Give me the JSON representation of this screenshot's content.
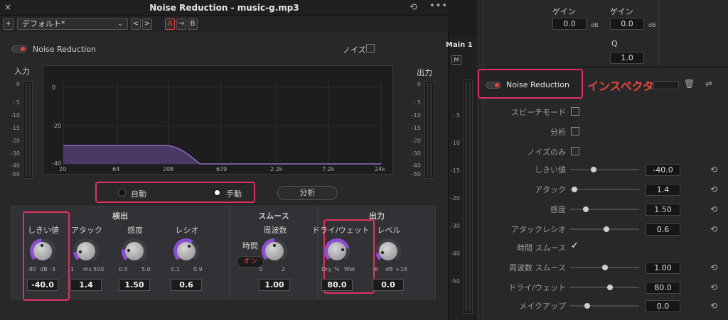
{
  "window": {
    "title": "Noise Reduction - music-g.mp3"
  },
  "toolbar": {
    "add": "+",
    "preset": "デフォルト*",
    "prev": "<",
    "next": ">",
    "ab_a": "A",
    "ab_arrow": "→",
    "ab_b": "B"
  },
  "plugin": {
    "enable_label": "Noise Reduction",
    "noise_label": "ノイズ",
    "input_label": "入力",
    "output_label": "出力",
    "meter_scale": [
      "0",
      "- 5",
      "-10",
      "-15",
      "-20",
      "-30",
      "-40",
      "-50"
    ],
    "graph_y": [
      "0",
      "-20",
      "-40"
    ],
    "graph_x": [
      "20",
      "64",
      "208",
      "679",
      "2.2k",
      "7.2k",
      "24k"
    ],
    "mode_auto": "自動",
    "mode_manual": "手動",
    "analyze": "分析",
    "sections": {
      "detect": "検出",
      "smooth": "スムース",
      "output": "出力"
    },
    "knobs": [
      {
        "label": "しきい値",
        "min": "-80",
        "unit": "dB",
        "max": "-3",
        "value": "-40.0"
      },
      {
        "label": "アタック",
        "min": "1",
        "unit": "ms",
        "max": "500",
        "value": "1.4"
      },
      {
        "label": "感度",
        "min": "0.5",
        "unit": "",
        "max": "5.0",
        "value": "1.50"
      },
      {
        "label": "レシオ",
        "min": "0.1",
        "unit": "",
        "max": "0.9",
        "value": "0.6"
      },
      {
        "label": "周波数",
        "min": "0",
        "unit": "",
        "max": "2",
        "value": "1.00"
      },
      {
        "label": "ドライ/ウェット",
        "min": "Dry",
        "unit": "%",
        "max": "Wet",
        "value": "80.0"
      },
      {
        "label": "レベル",
        "min": "-6",
        "unit": "dB",
        "max": "+18",
        "value": "0.0"
      }
    ],
    "time_label": "時間",
    "time_toggle": "オン",
    "level_zero": "0"
  },
  "mid": {
    "track": "Main 1",
    "m": "M",
    "scale": [
      "- 5",
      "-10",
      "-15",
      "-20",
      "-30",
      "-40",
      "-50"
    ]
  },
  "inspector": {
    "gain1_label": "ゲイン",
    "gain1_value": "0.0",
    "gain1_unit": "dB",
    "gain2_label": "ゲイン",
    "gain2_value": "0.0",
    "gain2_unit": "dB",
    "q_label": "Q",
    "q_value": "1.0",
    "header": "Noise Reduction",
    "annotation": "インスペクタ",
    "checks": [
      {
        "label": "スピーチモード",
        "checked": false
      },
      {
        "label": "分析",
        "checked": false
      },
      {
        "label": "ノイズのみ",
        "checked": false
      }
    ],
    "rows": [
      {
        "label": "しきい値",
        "value": "-40.0",
        "pos": 0.33
      },
      {
        "label": "アタック",
        "value": "1.4",
        "pos": 0.02
      },
      {
        "label": "感度",
        "value": "1.50",
        "pos": 0.2
      },
      {
        "label": "アタックレシオ",
        "value": "0.6",
        "pos": 0.53
      },
      {
        "label": "周波数 スムース",
        "value": "1.00",
        "pos": 0.5
      },
      {
        "label": "ドライ/ウェット",
        "value": "80.0",
        "pos": 0.58
      },
      {
        "label": "メイクアップ",
        "value": "0.0",
        "pos": 0.22
      }
    ],
    "time_smooth": "時間 スムース",
    "time_check": "✓"
  },
  "colors": {
    "accent": "#e0305f",
    "knob_arc": "#8a4fd0",
    "graph_fill": "#4a3a63",
    "red": "#e8443a"
  }
}
